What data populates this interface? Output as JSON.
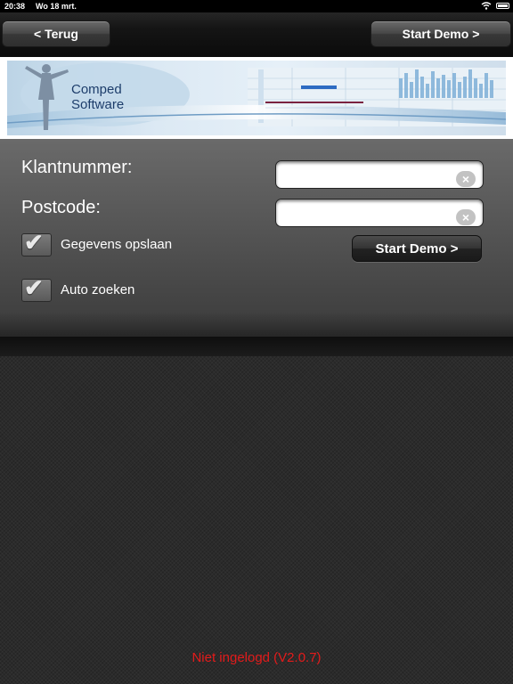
{
  "status_bar": {
    "time": "20:38",
    "date": "Wo 18 mrt.",
    "wifi_icon": "wifi-icon",
    "battery_icon": "battery-icon"
  },
  "nav": {
    "back_label": "< Terug",
    "forward_label": "Start Demo >"
  },
  "banner": {
    "logo_line1": "Comped",
    "logo_line2": "Software"
  },
  "form": {
    "customer_number_label": "Klantnummer:",
    "customer_number_value": "",
    "postcode_label": "Postcode:",
    "postcode_value": "",
    "save_data_label": "Gegevens opslaan",
    "save_data_checked": true,
    "auto_search_label": "Auto zoeken",
    "auto_search_checked": true,
    "start_demo_label": "Start Demo >",
    "clear_icon": "clear-icon",
    "check_icon": "checkmark-icon"
  },
  "footer": {
    "status_text": "Niet ingelogd (V2.0.7)"
  },
  "colors": {
    "status_text": "#e31b1b",
    "background": "#2b2b2b"
  }
}
